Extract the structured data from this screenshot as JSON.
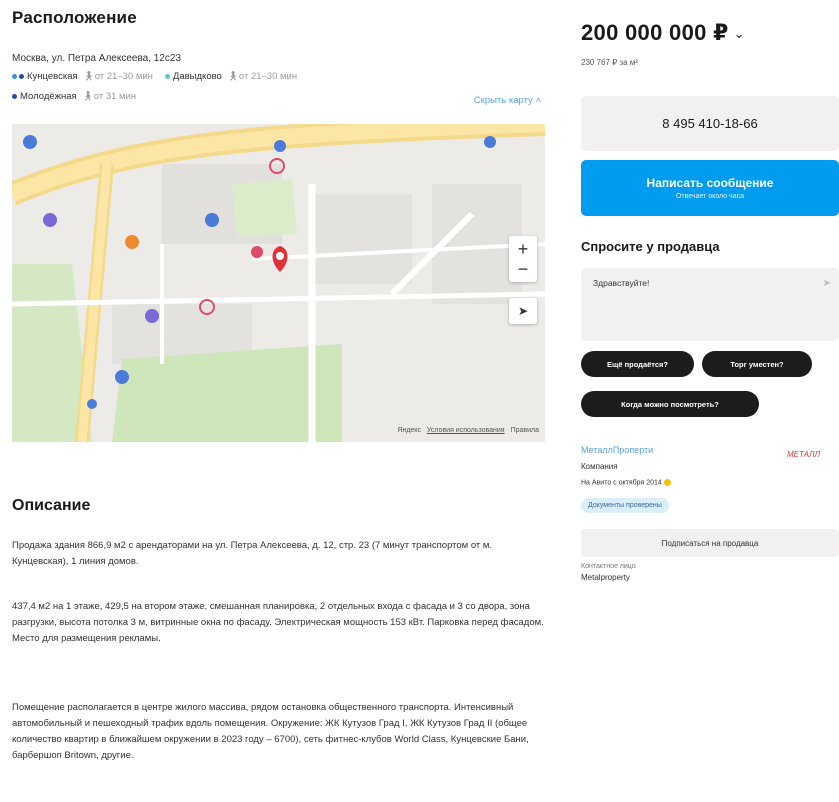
{
  "location": {
    "heading": "Расположение",
    "address": "Москва, ул. Петра Алексеева, 12с23",
    "metro": [
      {
        "name": "Кунцевская",
        "walk": "от 21–30 мин",
        "colors": [
          "#3a8de0",
          "#1f4fa8"
        ]
      },
      {
        "name": "Давыдково",
        "walk": "от 21–30 мин",
        "colors": [
          "#5ac8c8"
        ]
      },
      {
        "name": "Молодёжная",
        "walk": "от 31 мин",
        "colors": [
          "#1f4fa8"
        ]
      }
    ],
    "hide_map": "Скрыть карту",
    "map_attribution": {
      "brand": "Яндекс",
      "terms": "Условия использования",
      "right": "Правила"
    }
  },
  "description": {
    "heading": "Описание",
    "paragraphs": [
      "Продажа здания 866,9 м2 с арендаторами на ул. Петра Алексеева, д. 12, стр. 23 (7 минут транспортом от м. Кунцевская), 1 линия домов.",
      "437,4 м2 на 1 этаже, 429,5 на втором этаже, смешанная планировка, 2 отдельных входа с фасада и 3 со двора, зона разгрузки, высота потолка 3 м, витринные окна по фасаду. Электрическая мощность 153 кВт. Парковка перед фасадом. Место для размещения рекламы.",
      "Помещение располагается в центре жилого массива, рядом остановка общественного транспорта. Интенсивный автомобильный и пешеходный трафик вдоль помещения. Окружение: ЖК Кутузов Град I, ЖК Кутузов Град II (общее количество квартир в ближайшем окружении в 2023 году – 6700), сеть фитнес-клубов World Class, Кунцевские Бани, барбершоп Britown, другие."
    ]
  },
  "sidebar": {
    "price": "200 000 000 ₽",
    "price_sub": "230 767 ₽ за м²",
    "phone": "8 495 410-18-66",
    "message_button": "Написать сообщение",
    "message_sub": "Отвечает около часа",
    "ask_heading": "Спросите у продавца",
    "ask_text": "Здравствуйте!",
    "chips": [
      "Ещё продаётся?",
      "Торг уместен?",
      "Когда можно посмотреть?"
    ],
    "seller": {
      "name": "МеталлПроперти",
      "type": "Компания",
      "since": "На Авито с октября 2014",
      "docs": "Документы проверены",
      "logo": "МЕТАЛЛ"
    },
    "subscribe": "Подписаться на продавца",
    "contact_label": "Контактное лицо",
    "contact_name": "Metalproperty"
  }
}
